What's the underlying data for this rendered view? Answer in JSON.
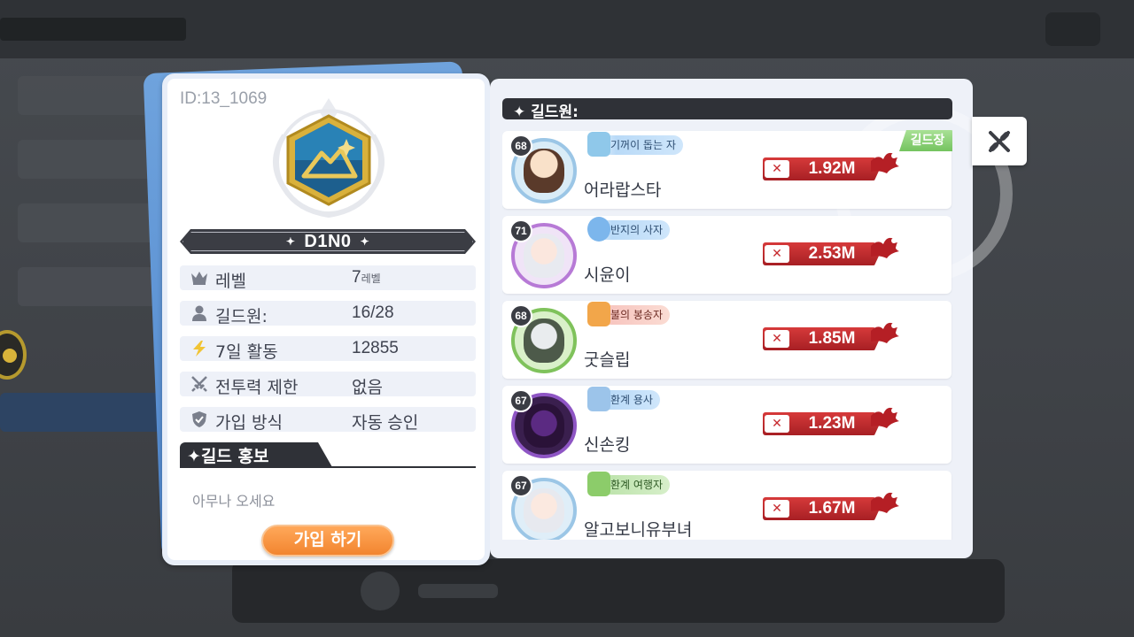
{
  "colors": {
    "panel_bg": "#eef1f8",
    "dark_header": "#2f3137",
    "power_red": "#b82127",
    "join_orange": "#f2852f",
    "leader_green": "#74c35f",
    "card_back_blue": "#5b92d4"
  },
  "guild": {
    "id_text": "ID:13_1069",
    "name": "D1N0",
    "name_decor": "✦",
    "emblem_icon": "mountain-emblem-icon",
    "info": [
      {
        "icon": "crown-icon",
        "label": "레벨",
        "value": "7",
        "unit": "레벨"
      },
      {
        "icon": "person-icon",
        "label": "길드원:",
        "value": "16/28",
        "unit": ""
      },
      {
        "icon": "lightning-icon",
        "label": "7일 활동",
        "value": "12855",
        "unit": ""
      },
      {
        "icon": "crossed-swords-icon",
        "label": "전투력 제한",
        "value": "없음",
        "unit": ""
      },
      {
        "icon": "shield-icon",
        "label": "가입 방식",
        "value": "자동 승인",
        "unit": ""
      }
    ],
    "promo_title": "✦길드 홍보",
    "promo_text": "아무나 오세요",
    "join_button": "가입 하기"
  },
  "members_panel": {
    "title": "✦ 길드원:",
    "leader_tag": "길드장",
    "members": [
      {
        "level": "68",
        "title": "기꺼이 돕는 자",
        "title_style": "blue",
        "name": "어라랍스타",
        "power": "1.92M",
        "is_leader": true
      },
      {
        "level": "71",
        "title": "반지의 사자",
        "title_style": "blue",
        "name": "시윤이",
        "power": "2.53M",
        "is_leader": false
      },
      {
        "level": "68",
        "title": "불의 봉송자",
        "title_style": "fire",
        "name": "굿슬립",
        "power": "1.85M",
        "is_leader": false
      },
      {
        "level": "67",
        "title": "환계 용사",
        "title_style": "blue",
        "name": "신손킹",
        "power": "1.23M",
        "is_leader": false
      },
      {
        "level": "67",
        "title": "환계 여행자",
        "title_style": "green",
        "name": "알고보니유부녀",
        "power": "1.67M",
        "is_leader": false
      }
    ]
  },
  "close_icon": "close-icon"
}
